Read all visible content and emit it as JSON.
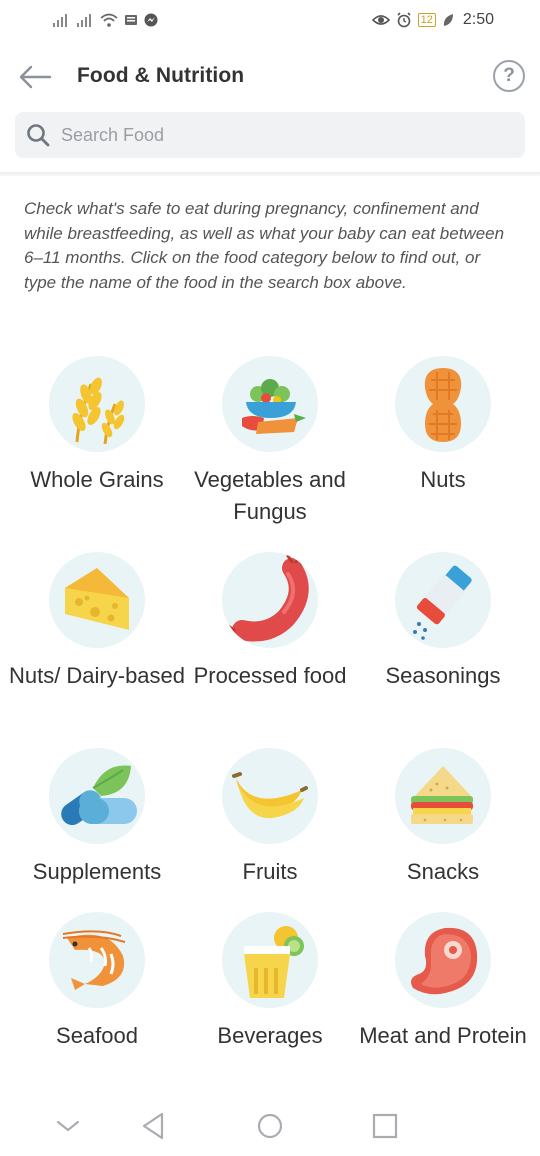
{
  "status_bar": {
    "time": "2:50",
    "battery": "12"
  },
  "header": {
    "title": "Food & Nutrition",
    "help_label": "?"
  },
  "search": {
    "placeholder": "Search Food",
    "value": ""
  },
  "intro_text": "Check what's safe to eat during pregnancy, confinement and while breastfeeding, as well as what your baby can eat between 6–11 months. Click on the food category below to find out, or type the name of the food in the search box above.",
  "categories": [
    {
      "label": "Whole Grains",
      "icon": "wheat-icon"
    },
    {
      "label": "Vegetables and Fungus",
      "icon": "vegetable-bowl-icon"
    },
    {
      "label": "Nuts",
      "icon": "peanut-icon"
    },
    {
      "label": "Nuts/ Dairy-based",
      "icon": "cheese-icon"
    },
    {
      "label": "Processed food",
      "icon": "sausage-icon"
    },
    {
      "label": "Seasonings",
      "icon": "salt-shaker-icon"
    },
    {
      "label": "Supplements",
      "icon": "pill-leaf-icon"
    },
    {
      "label": "Fruits",
      "icon": "banana-icon"
    },
    {
      "label": "Snacks",
      "icon": "sandwich-icon"
    },
    {
      "label": "Seafood",
      "icon": "shrimp-icon"
    },
    {
      "label": "Beverages",
      "icon": "drink-glass-icon"
    },
    {
      "label": "Meat and Protein",
      "icon": "steak-icon"
    }
  ],
  "colors": {
    "icon_circle": "#e9f4f6",
    "search_bg": "#f1f2f4"
  }
}
